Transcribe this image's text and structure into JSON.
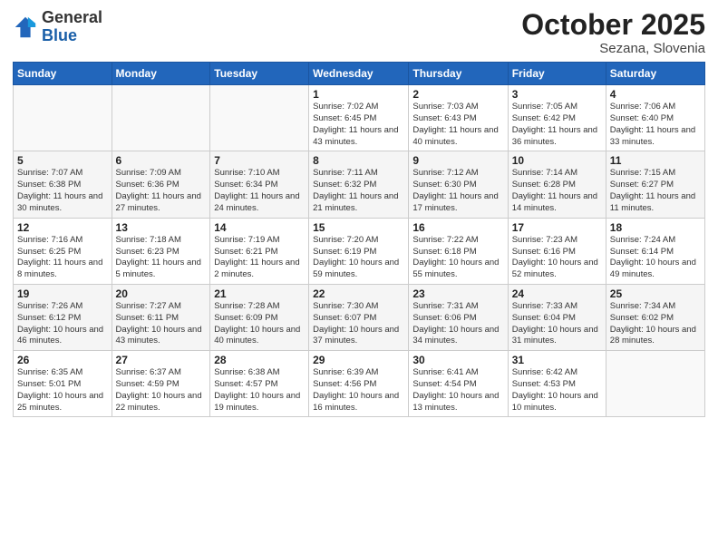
{
  "logo": {
    "general": "General",
    "blue": "Blue"
  },
  "header": {
    "month": "October 2025",
    "location": "Sezana, Slovenia"
  },
  "days_of_week": [
    "Sunday",
    "Monday",
    "Tuesday",
    "Wednesday",
    "Thursday",
    "Friday",
    "Saturday"
  ],
  "weeks": [
    [
      {
        "day": "",
        "info": ""
      },
      {
        "day": "",
        "info": ""
      },
      {
        "day": "",
        "info": ""
      },
      {
        "day": "1",
        "info": "Sunrise: 7:02 AM\nSunset: 6:45 PM\nDaylight: 11 hours and 43 minutes."
      },
      {
        "day": "2",
        "info": "Sunrise: 7:03 AM\nSunset: 6:43 PM\nDaylight: 11 hours and 40 minutes."
      },
      {
        "day": "3",
        "info": "Sunrise: 7:05 AM\nSunset: 6:42 PM\nDaylight: 11 hours and 36 minutes."
      },
      {
        "day": "4",
        "info": "Sunrise: 7:06 AM\nSunset: 6:40 PM\nDaylight: 11 hours and 33 minutes."
      }
    ],
    [
      {
        "day": "5",
        "info": "Sunrise: 7:07 AM\nSunset: 6:38 PM\nDaylight: 11 hours and 30 minutes."
      },
      {
        "day": "6",
        "info": "Sunrise: 7:09 AM\nSunset: 6:36 PM\nDaylight: 11 hours and 27 minutes."
      },
      {
        "day": "7",
        "info": "Sunrise: 7:10 AM\nSunset: 6:34 PM\nDaylight: 11 hours and 24 minutes."
      },
      {
        "day": "8",
        "info": "Sunrise: 7:11 AM\nSunset: 6:32 PM\nDaylight: 11 hours and 21 minutes."
      },
      {
        "day": "9",
        "info": "Sunrise: 7:12 AM\nSunset: 6:30 PM\nDaylight: 11 hours and 17 minutes."
      },
      {
        "day": "10",
        "info": "Sunrise: 7:14 AM\nSunset: 6:28 PM\nDaylight: 11 hours and 14 minutes."
      },
      {
        "day": "11",
        "info": "Sunrise: 7:15 AM\nSunset: 6:27 PM\nDaylight: 11 hours and 11 minutes."
      }
    ],
    [
      {
        "day": "12",
        "info": "Sunrise: 7:16 AM\nSunset: 6:25 PM\nDaylight: 11 hours and 8 minutes."
      },
      {
        "day": "13",
        "info": "Sunrise: 7:18 AM\nSunset: 6:23 PM\nDaylight: 11 hours and 5 minutes."
      },
      {
        "day": "14",
        "info": "Sunrise: 7:19 AM\nSunset: 6:21 PM\nDaylight: 11 hours and 2 minutes."
      },
      {
        "day": "15",
        "info": "Sunrise: 7:20 AM\nSunset: 6:19 PM\nDaylight: 10 hours and 59 minutes."
      },
      {
        "day": "16",
        "info": "Sunrise: 7:22 AM\nSunset: 6:18 PM\nDaylight: 10 hours and 55 minutes."
      },
      {
        "day": "17",
        "info": "Sunrise: 7:23 AM\nSunset: 6:16 PM\nDaylight: 10 hours and 52 minutes."
      },
      {
        "day": "18",
        "info": "Sunrise: 7:24 AM\nSunset: 6:14 PM\nDaylight: 10 hours and 49 minutes."
      }
    ],
    [
      {
        "day": "19",
        "info": "Sunrise: 7:26 AM\nSunset: 6:12 PM\nDaylight: 10 hours and 46 minutes."
      },
      {
        "day": "20",
        "info": "Sunrise: 7:27 AM\nSunset: 6:11 PM\nDaylight: 10 hours and 43 minutes."
      },
      {
        "day": "21",
        "info": "Sunrise: 7:28 AM\nSunset: 6:09 PM\nDaylight: 10 hours and 40 minutes."
      },
      {
        "day": "22",
        "info": "Sunrise: 7:30 AM\nSunset: 6:07 PM\nDaylight: 10 hours and 37 minutes."
      },
      {
        "day": "23",
        "info": "Sunrise: 7:31 AM\nSunset: 6:06 PM\nDaylight: 10 hours and 34 minutes."
      },
      {
        "day": "24",
        "info": "Sunrise: 7:33 AM\nSunset: 6:04 PM\nDaylight: 10 hours and 31 minutes."
      },
      {
        "day": "25",
        "info": "Sunrise: 7:34 AM\nSunset: 6:02 PM\nDaylight: 10 hours and 28 minutes."
      }
    ],
    [
      {
        "day": "26",
        "info": "Sunrise: 6:35 AM\nSunset: 5:01 PM\nDaylight: 10 hours and 25 minutes."
      },
      {
        "day": "27",
        "info": "Sunrise: 6:37 AM\nSunset: 4:59 PM\nDaylight: 10 hours and 22 minutes."
      },
      {
        "day": "28",
        "info": "Sunrise: 6:38 AM\nSunset: 4:57 PM\nDaylight: 10 hours and 19 minutes."
      },
      {
        "day": "29",
        "info": "Sunrise: 6:39 AM\nSunset: 4:56 PM\nDaylight: 10 hours and 16 minutes."
      },
      {
        "day": "30",
        "info": "Sunrise: 6:41 AM\nSunset: 4:54 PM\nDaylight: 10 hours and 13 minutes."
      },
      {
        "day": "31",
        "info": "Sunrise: 6:42 AM\nSunset: 4:53 PM\nDaylight: 10 hours and 10 minutes."
      },
      {
        "day": "",
        "info": ""
      }
    ]
  ]
}
